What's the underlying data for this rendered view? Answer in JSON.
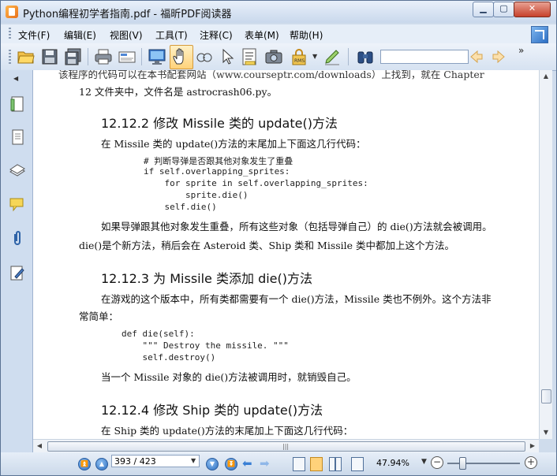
{
  "window": {
    "title": "Python编程初学者指南.pdf - 福昕PDF阅读器",
    "min_glyph": "▁",
    "max_glyph": "▢",
    "close_glyph": "✕"
  },
  "menu": [
    "文件(F)",
    "编辑(E)",
    "视图(V)",
    "工具(T)",
    "注释(C)",
    "表单(M)",
    "帮助(H)"
  ],
  "toolbar": {
    "icons": [
      "open-folder-icon",
      "save-icon",
      "save-all-icon",
      "print-icon",
      "scan-icon",
      "monitor-icon",
      "hand-tool-icon",
      "zoom-glass-icon",
      "select-arrow-icon",
      "text-select-icon",
      "snapshot-camera-icon",
      "rms-lock-icon",
      "sign-pen-icon",
      "find-binoculars-icon"
    ],
    "rms_label": "RMS",
    "search_value": "",
    "more": "»"
  },
  "document": {
    "line_top": "该程序的代码可以在本书配套网站（www.courseptr.com/downloads）上找到，就在 Chapter",
    "line_top2": "12 文件夹中，文件名是 astrocrash06.py。",
    "h1": "12.12.2   修改 Missile 类的 update()方法",
    "p1": "在 Missile 类的 update()方法的末尾加上下面这几行代码：",
    "code1": [
      "# 判断导弹是否跟其他对象发生了重叠",
      "if self.overlapping_sprites:",
      "    for sprite in self.overlapping_sprites:",
      "        sprite.die()",
      "    self.die()"
    ],
    "p2a": "如果导弹跟其他对象发生重叠，所有这些对象（包括导弹自己）的 die()方法就会被调用。",
    "p2b": "die()是个新方法，稍后会在 Asteroid 类、Ship 类和 Missile 类中都加上这个方法。",
    "h2": "12.12.3   为 Missile 类添加 die()方法",
    "p3a": "在游戏的这个版本中，所有类都需要有一个 die()方法，Missile 类也不例外。这个方法非",
    "p3b": "常简单：",
    "code2": [
      "def die(self):",
      "    \"\"\" Destroy the missile. \"\"\"",
      "    self.destroy()"
    ],
    "p4": "当一个 Missile 对象的 die()方法被调用时，就销毁自己。",
    "h3": "12.12.4   修改 Ship 类的 update()方法",
    "p5": "在 Ship 类的 update()方法的末尾加上下面这几行代码："
  },
  "statusbar": {
    "page": "393 / 423",
    "zoom": "47.94%",
    "scroll_grip": "|||"
  }
}
